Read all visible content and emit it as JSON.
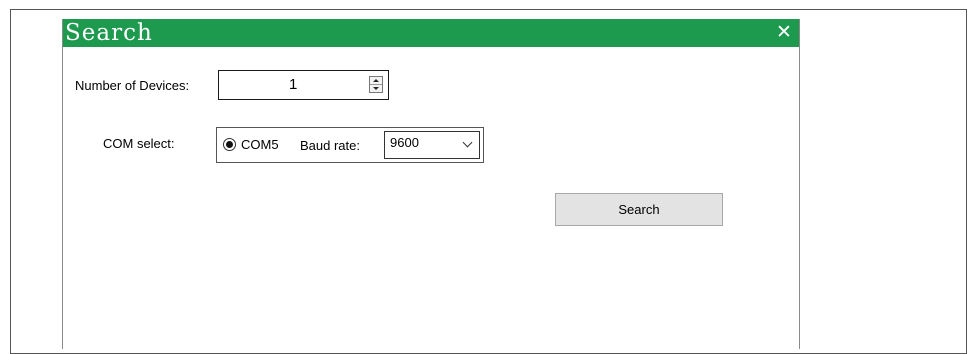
{
  "dialog": {
    "title": "Search",
    "close_glyph": "✕",
    "accent_color": "#1e9a4e"
  },
  "device_count": {
    "label": "Number of Devices:",
    "value": "1"
  },
  "com": {
    "label": "COM select:",
    "port_label": "COM5",
    "port_selected": true,
    "baud_label": "Baud rate:",
    "baud_value": "9600"
  },
  "actions": {
    "search_label": "Search"
  },
  "icons": {
    "close": "close-icon",
    "spin_up": "spin-up-icon",
    "spin_down": "spin-down-icon",
    "dropdown": "chevron-down-icon",
    "radio": "radio-selected-icon"
  }
}
